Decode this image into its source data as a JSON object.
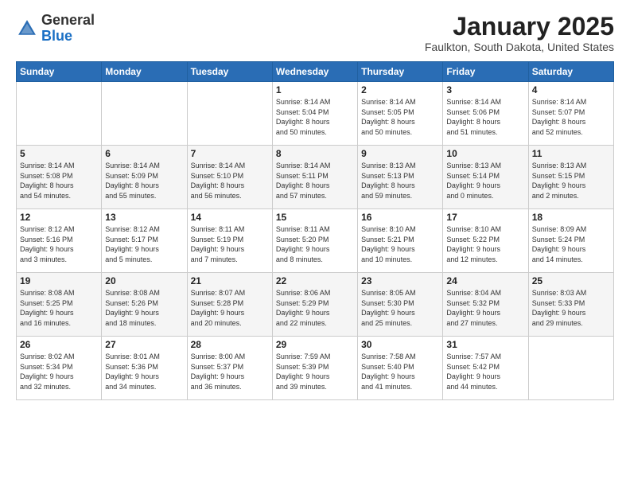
{
  "header": {
    "logo_general": "General",
    "logo_blue": "Blue",
    "month_title": "January 2025",
    "location": "Faulkton, South Dakota, United States"
  },
  "weekdays": [
    "Sunday",
    "Monday",
    "Tuesday",
    "Wednesday",
    "Thursday",
    "Friday",
    "Saturday"
  ],
  "weeks": [
    [
      {
        "day": "",
        "info": ""
      },
      {
        "day": "",
        "info": ""
      },
      {
        "day": "",
        "info": ""
      },
      {
        "day": "1",
        "info": "Sunrise: 8:14 AM\nSunset: 5:04 PM\nDaylight: 8 hours\nand 50 minutes."
      },
      {
        "day": "2",
        "info": "Sunrise: 8:14 AM\nSunset: 5:05 PM\nDaylight: 8 hours\nand 50 minutes."
      },
      {
        "day": "3",
        "info": "Sunrise: 8:14 AM\nSunset: 5:06 PM\nDaylight: 8 hours\nand 51 minutes."
      },
      {
        "day": "4",
        "info": "Sunrise: 8:14 AM\nSunset: 5:07 PM\nDaylight: 8 hours\nand 52 minutes."
      }
    ],
    [
      {
        "day": "5",
        "info": "Sunrise: 8:14 AM\nSunset: 5:08 PM\nDaylight: 8 hours\nand 54 minutes."
      },
      {
        "day": "6",
        "info": "Sunrise: 8:14 AM\nSunset: 5:09 PM\nDaylight: 8 hours\nand 55 minutes."
      },
      {
        "day": "7",
        "info": "Sunrise: 8:14 AM\nSunset: 5:10 PM\nDaylight: 8 hours\nand 56 minutes."
      },
      {
        "day": "8",
        "info": "Sunrise: 8:14 AM\nSunset: 5:11 PM\nDaylight: 8 hours\nand 57 minutes."
      },
      {
        "day": "9",
        "info": "Sunrise: 8:13 AM\nSunset: 5:13 PM\nDaylight: 8 hours\nand 59 minutes."
      },
      {
        "day": "10",
        "info": "Sunrise: 8:13 AM\nSunset: 5:14 PM\nDaylight: 9 hours\nand 0 minutes."
      },
      {
        "day": "11",
        "info": "Sunrise: 8:13 AM\nSunset: 5:15 PM\nDaylight: 9 hours\nand 2 minutes."
      }
    ],
    [
      {
        "day": "12",
        "info": "Sunrise: 8:12 AM\nSunset: 5:16 PM\nDaylight: 9 hours\nand 3 minutes."
      },
      {
        "day": "13",
        "info": "Sunrise: 8:12 AM\nSunset: 5:17 PM\nDaylight: 9 hours\nand 5 minutes."
      },
      {
        "day": "14",
        "info": "Sunrise: 8:11 AM\nSunset: 5:19 PM\nDaylight: 9 hours\nand 7 minutes."
      },
      {
        "day": "15",
        "info": "Sunrise: 8:11 AM\nSunset: 5:20 PM\nDaylight: 9 hours\nand 8 minutes."
      },
      {
        "day": "16",
        "info": "Sunrise: 8:10 AM\nSunset: 5:21 PM\nDaylight: 9 hours\nand 10 minutes."
      },
      {
        "day": "17",
        "info": "Sunrise: 8:10 AM\nSunset: 5:22 PM\nDaylight: 9 hours\nand 12 minutes."
      },
      {
        "day": "18",
        "info": "Sunrise: 8:09 AM\nSunset: 5:24 PM\nDaylight: 9 hours\nand 14 minutes."
      }
    ],
    [
      {
        "day": "19",
        "info": "Sunrise: 8:08 AM\nSunset: 5:25 PM\nDaylight: 9 hours\nand 16 minutes."
      },
      {
        "day": "20",
        "info": "Sunrise: 8:08 AM\nSunset: 5:26 PM\nDaylight: 9 hours\nand 18 minutes."
      },
      {
        "day": "21",
        "info": "Sunrise: 8:07 AM\nSunset: 5:28 PM\nDaylight: 9 hours\nand 20 minutes."
      },
      {
        "day": "22",
        "info": "Sunrise: 8:06 AM\nSunset: 5:29 PM\nDaylight: 9 hours\nand 22 minutes."
      },
      {
        "day": "23",
        "info": "Sunrise: 8:05 AM\nSunset: 5:30 PM\nDaylight: 9 hours\nand 25 minutes."
      },
      {
        "day": "24",
        "info": "Sunrise: 8:04 AM\nSunset: 5:32 PM\nDaylight: 9 hours\nand 27 minutes."
      },
      {
        "day": "25",
        "info": "Sunrise: 8:03 AM\nSunset: 5:33 PM\nDaylight: 9 hours\nand 29 minutes."
      }
    ],
    [
      {
        "day": "26",
        "info": "Sunrise: 8:02 AM\nSunset: 5:34 PM\nDaylight: 9 hours\nand 32 minutes."
      },
      {
        "day": "27",
        "info": "Sunrise: 8:01 AM\nSunset: 5:36 PM\nDaylight: 9 hours\nand 34 minutes."
      },
      {
        "day": "28",
        "info": "Sunrise: 8:00 AM\nSunset: 5:37 PM\nDaylight: 9 hours\nand 36 minutes."
      },
      {
        "day": "29",
        "info": "Sunrise: 7:59 AM\nSunset: 5:39 PM\nDaylight: 9 hours\nand 39 minutes."
      },
      {
        "day": "30",
        "info": "Sunrise: 7:58 AM\nSunset: 5:40 PM\nDaylight: 9 hours\nand 41 minutes."
      },
      {
        "day": "31",
        "info": "Sunrise: 7:57 AM\nSunset: 5:42 PM\nDaylight: 9 hours\nand 44 minutes."
      },
      {
        "day": "",
        "info": ""
      }
    ]
  ]
}
